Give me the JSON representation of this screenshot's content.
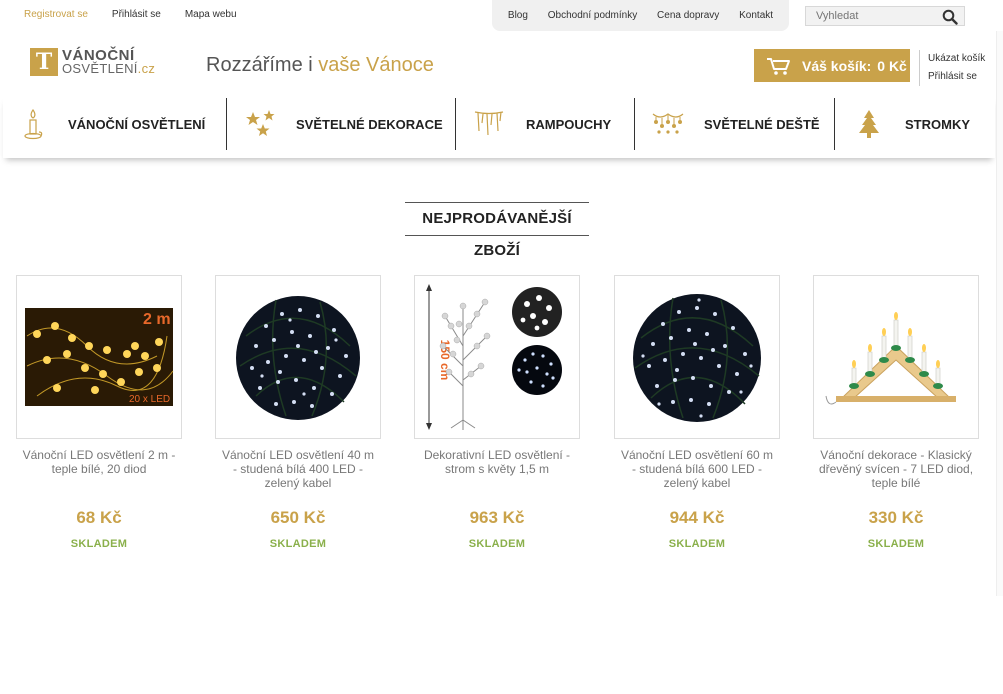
{
  "topbar": {
    "register": "Registrovat se",
    "login": "Přihlásit se",
    "sitemap": "Mapa webu",
    "links": [
      "Blog",
      "Obchodní podmínky",
      "Cena dopravy",
      "Kontakt"
    ],
    "search_placeholder": "Vyhledat"
  },
  "header": {
    "logo_line1": "VÁNOČNÍ",
    "logo_line2": "OSVĚTLENÍ",
    "logo_tld": ".cz",
    "logo_letter": "T",
    "slogan_part1": "Rozzáříme i ",
    "slogan_part2": "vaše Vánoce",
    "cart_label": "Váš košík:",
    "cart_value": "0 Kč",
    "show_cart": "Ukázat košík",
    "login": "Přihlásit se"
  },
  "nav": [
    {
      "label": "VÁNOČNÍ OSVĚTLENÍ",
      "icon": "candle-icon"
    },
    {
      "label": "SVĚTELNÉ DEKORACE",
      "icon": "stars-icon"
    },
    {
      "label": "RAMPOUCHY",
      "icon": "icicles-icon"
    },
    {
      "label": "SVĚTELNÉ DEŠTĚ",
      "icon": "light-rain-icon"
    },
    {
      "label": "STROMKY",
      "icon": "tree-icon"
    }
  ],
  "section_title": "NEJPRODÁVANĚJŠÍ ZBOŽÍ",
  "products": [
    {
      "name": "Vánoční LED osvětlení 2 m - teple bílé, 20 diod",
      "price": "68 Kč",
      "stock": "SKLADEM",
      "img_label": "2 m",
      "img_label2": "20 x LED"
    },
    {
      "name": "Vánoční LED osvětlení 40 m - studená bílá 400 LED - zelený kabel",
      "price": "650 Kč",
      "stock": "SKLADEM"
    },
    {
      "name": "Dekorativní LED osvětlení - strom s květy 1,5 m",
      "price": "963 Kč",
      "stock": "SKLADEM",
      "img_label": "150 cm"
    },
    {
      "name": "Vánoční LED osvětlení 60 m - studená bílá 600 LED - zelený kabel",
      "price": "944 Kč",
      "stock": "SKLADEM"
    },
    {
      "name": "Vánoční dekorace - Klasický dřevěný svícen - 7 LED diod, teple bílé",
      "price": "330 Kč",
      "stock": "SKLADEM"
    }
  ],
  "colors": {
    "gold": "#c9a24a",
    "stock_green": "#8ab04b"
  }
}
